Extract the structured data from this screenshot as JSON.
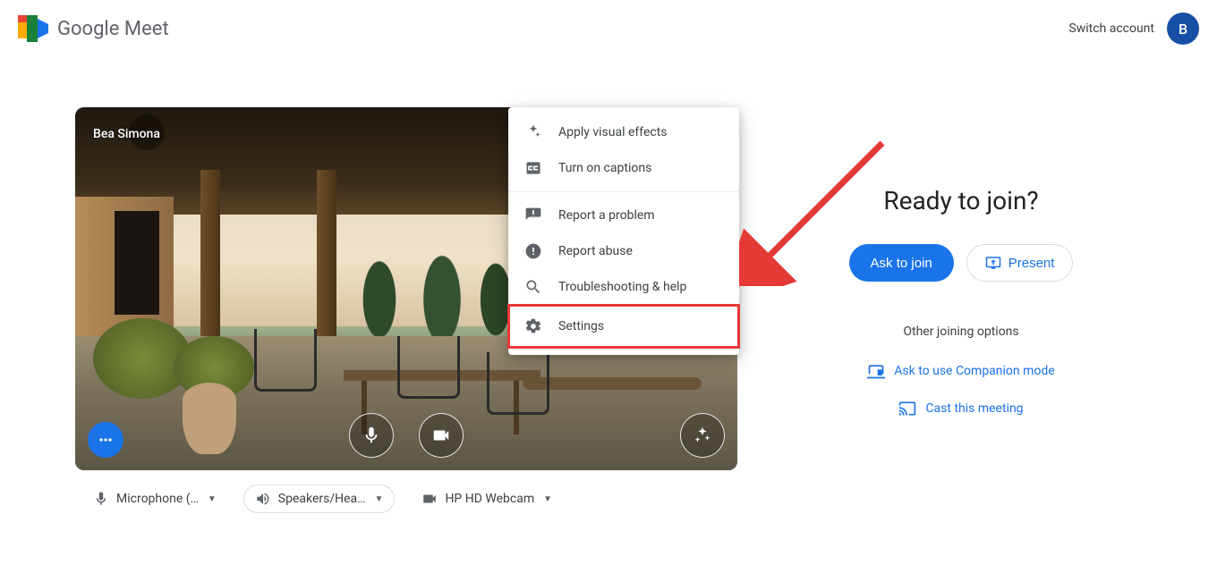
{
  "header": {
    "product_name": "Google Meet",
    "switch_account": "Switch account",
    "avatar_initial": "B"
  },
  "preview": {
    "participant_name": "Bea Simona"
  },
  "menu": {
    "items": [
      {
        "label": "Apply visual effects"
      },
      {
        "label": "Turn on captions"
      },
      {
        "label": "Report a problem"
      },
      {
        "label": "Report abuse"
      },
      {
        "label": "Troubleshooting & help"
      },
      {
        "label": "Settings"
      }
    ]
  },
  "devices": {
    "mic": "Microphone (…",
    "speaker": "Speakers/Hea…",
    "camera": "HP HD Webcam"
  },
  "join": {
    "ready_title": "Ready to join?",
    "ask_to_join": "Ask to join",
    "present": "Present",
    "other_options": "Other joining options",
    "companion": "Ask to use Companion mode",
    "cast": "Cast this meeting"
  }
}
